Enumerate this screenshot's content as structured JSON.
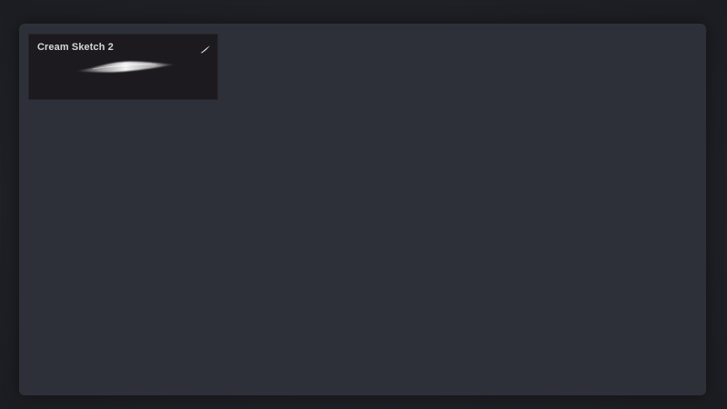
{
  "brush_library": {
    "brushes": [
      {
        "name": "Cream Sketch 2",
        "icon": "brush-stroke-icon",
        "preview": "stroke-preview"
      }
    ]
  },
  "colors": {
    "background": "#1f2026",
    "panel": "#2d3038",
    "card": "#1c1a1f",
    "text": "#d6d6d8"
  }
}
